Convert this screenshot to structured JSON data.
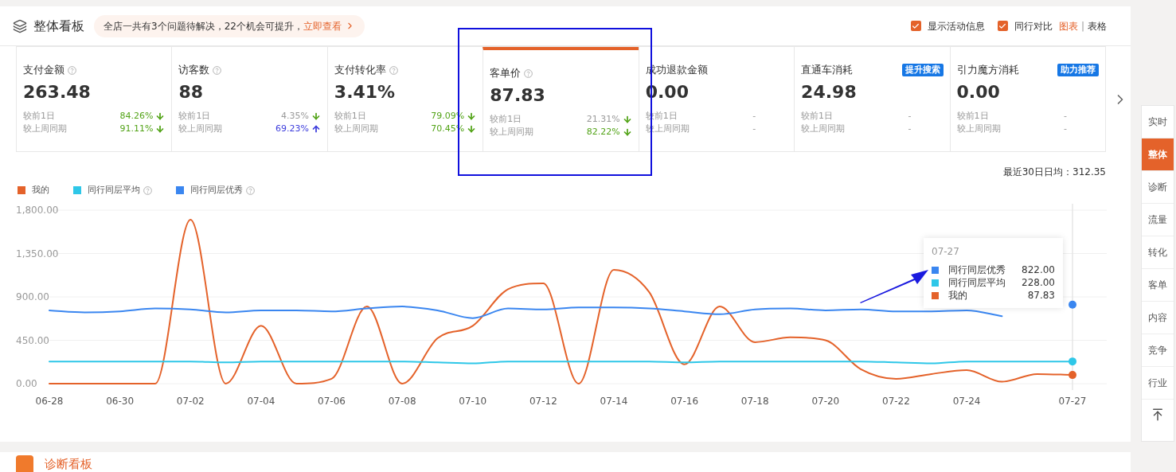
{
  "header": {
    "title": "整体看板",
    "notice": {
      "text": "全店一共有3个问题待解决，22个机会可提升，",
      "link": "立即查看"
    },
    "options": [
      {
        "label": "显示活动信息",
        "checked": true
      },
      {
        "label": "同行对比",
        "checked": true
      }
    ],
    "views": [
      {
        "label": "图表",
        "selected": true
      },
      {
        "label": "表格",
        "selected": false
      }
    ],
    "view_separator": "|"
  },
  "metrics": [
    {
      "name": "支付金额",
      "help": true,
      "value": "263.48",
      "selected": false,
      "compare": [
        {
          "label": "较前1日",
          "value": "84.26%",
          "kind": "down",
          "color": "#52a317"
        },
        {
          "label": "较上周同期",
          "value": "91.11%",
          "kind": "down",
          "color": "#52a317"
        }
      ]
    },
    {
      "name": "访客数",
      "help": true,
      "value": "88",
      "selected": false,
      "compare": [
        {
          "label": "较前1日",
          "value": "4.35%",
          "kind": "down",
          "color": "#999999"
        },
        {
          "label": "较上周同期",
          "value": "69.23%",
          "kind": "up",
          "color": "#3c3cdc"
        }
      ]
    },
    {
      "name": "支付转化率",
      "help": true,
      "value": "3.41%",
      "selected": false,
      "compare": [
        {
          "label": "较前1日",
          "value": "79.09%",
          "kind": "down",
          "color": "#52a317"
        },
        {
          "label": "较上周同期",
          "value": "70.45%",
          "kind": "down",
          "color": "#52a317"
        }
      ]
    },
    {
      "name": "客单价",
      "help": true,
      "value": "87.83",
      "selected": true,
      "compare": [
        {
          "label": "较前1日",
          "value": "21.31%",
          "kind": "down",
          "color": "#999999"
        },
        {
          "label": "较上周同期",
          "value": "82.22%",
          "kind": "down",
          "color": "#52a317"
        }
      ]
    },
    {
      "name": "成功退款金额",
      "help": false,
      "value": "0.00",
      "selected": false,
      "compare": [
        {
          "label": "较前1日",
          "value": "-",
          "kind": "none"
        },
        {
          "label": "较上周同期",
          "value": "-",
          "kind": "none"
        }
      ]
    },
    {
      "name": "直通车消耗",
      "help": false,
      "badge": "提升搜索",
      "value": "24.98",
      "selected": false,
      "compare": [
        {
          "label": "较前1日",
          "value": "-",
          "kind": "none"
        },
        {
          "label": "较上周同期",
          "value": "-",
          "kind": "none"
        }
      ]
    },
    {
      "name": "引力魔方消耗",
      "help": false,
      "badge": "助力推荐",
      "value": "0.00",
      "selected": false,
      "compare": [
        {
          "label": "较前1日",
          "value": "-",
          "kind": "none"
        },
        {
          "label": "较上周同期",
          "value": "-",
          "kind": "none"
        }
      ]
    }
  ],
  "average": "最近30日日均：312.35",
  "legend_help": [
    {
      "help": false
    },
    {
      "help": true
    },
    {
      "help": true
    }
  ],
  "chart_data": {
    "type": "line",
    "grid": true,
    "legend": "upper left",
    "categories": [
      "06-28",
      null,
      "06-30",
      null,
      "07-02",
      null,
      "07-04",
      null,
      "07-06",
      null,
      "07-08",
      null,
      "07-10",
      null,
      "07-12",
      null,
      "07-14",
      null,
      "07-16",
      null,
      "07-18",
      null,
      "07-20",
      null,
      "07-22",
      null,
      "07-24",
      null,
      null,
      "07-27"
    ],
    "ref_lines": [
      {
        "axis": "x",
        "value": "07-27",
        "color": "#e6e6e6"
      }
    ],
    "series": [
      {
        "name": "我的",
        "color": "#e4622a",
        "values": [
          0,
          0,
          0,
          0,
          1700,
          0,
          600,
          0,
          50,
          800,
          0,
          470,
          600,
          980,
          1040,
          0,
          1180,
          950,
          200,
          800,
          430,
          480,
          450,
          150,
          50,
          100,
          140,
          20,
          100,
          90
        ]
      },
      {
        "name": "同行同层平均",
        "color": "#2ec7e8",
        "values": [
          230,
          230,
          230,
          230,
          230,
          220,
          230,
          230,
          230,
          230,
          230,
          220,
          210,
          230,
          230,
          230,
          230,
          230,
          220,
          230,
          230,
          230,
          230,
          230,
          220,
          210,
          230,
          230,
          230,
          230
        ]
      },
      {
        "name": "同行同层优秀",
        "color": "#3a86f0",
        "values": [
          760,
          740,
          750,
          780,
          770,
          740,
          760,
          760,
          750,
          780,
          800,
          760,
          680,
          780,
          770,
          790,
          790,
          780,
          750,
          720,
          770,
          780,
          760,
          770,
          750,
          750,
          760,
          700,
          null,
          820
        ]
      }
    ],
    "ylim": [
      0,
      1800
    ],
    "yticks": [
      {
        "value": 0,
        "label": "0.00"
      },
      {
        "value": 450,
        "label": "450.00"
      },
      {
        "value": 900,
        "label": "900.00"
      },
      {
        "value": 1350,
        "label": "1,350.00"
      },
      {
        "value": 1800,
        "label": "1,800.00"
      }
    ]
  },
  "tooltip": {
    "title": "07-27",
    "items": [
      {
        "label": "同行同层优秀",
        "value": "822.00",
        "color": "#3a86f0"
      },
      {
        "label": "同行同层平均",
        "value": "228.00",
        "color": "#2ec7e8"
      },
      {
        "label": "我的",
        "value": "87.83",
        "color": "#e4622a"
      }
    ]
  },
  "side_nav": [
    {
      "label": "实时",
      "selected": false
    },
    {
      "label": "整体",
      "selected": true
    },
    {
      "label": "诊断",
      "selected": false
    },
    {
      "label": "流量",
      "selected": false
    },
    {
      "label": "转化",
      "selected": false
    },
    {
      "label": "客单",
      "selected": false
    },
    {
      "label": "内容",
      "selected": false
    },
    {
      "label": "竞争",
      "selected": false
    },
    {
      "label": "行业",
      "selected": false
    }
  ],
  "next_section": {
    "title": "诊断看板"
  }
}
